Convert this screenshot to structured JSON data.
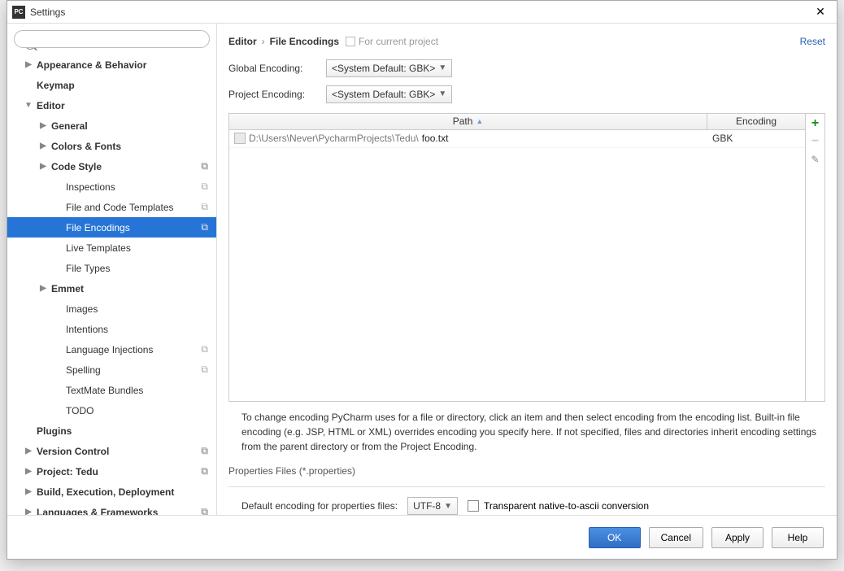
{
  "window": {
    "title": "Settings"
  },
  "sidebar": {
    "search_placeholder": "",
    "items": [
      {
        "label": "Appearance & Behavior",
        "level": 0,
        "arrow": "▶",
        "bold": true
      },
      {
        "label": "Keymap",
        "level": 0,
        "arrow": "",
        "bold": true
      },
      {
        "label": "Editor",
        "level": 0,
        "arrow": "▼",
        "bold": true
      },
      {
        "label": "General",
        "level": 1,
        "arrow": "▶"
      },
      {
        "label": "Colors & Fonts",
        "level": 1,
        "arrow": "▶"
      },
      {
        "label": "Code Style",
        "level": 1,
        "arrow": "▶",
        "badge": true
      },
      {
        "label": "Inspections",
        "level": 2,
        "arrow": "",
        "badge": true
      },
      {
        "label": "File and Code Templates",
        "level": 2,
        "arrow": "",
        "badge": true
      },
      {
        "label": "File Encodings",
        "level": 2,
        "arrow": "",
        "badge": true,
        "selected": true
      },
      {
        "label": "Live Templates",
        "level": 2,
        "arrow": ""
      },
      {
        "label": "File Types",
        "level": 2,
        "arrow": ""
      },
      {
        "label": "Emmet",
        "level": 1,
        "arrow": "▶"
      },
      {
        "label": "Images",
        "level": 2,
        "arrow": ""
      },
      {
        "label": "Intentions",
        "level": 2,
        "arrow": ""
      },
      {
        "label": "Language Injections",
        "level": 2,
        "arrow": "",
        "badge": true
      },
      {
        "label": "Spelling",
        "level": 2,
        "arrow": "",
        "badge": true
      },
      {
        "label": "TextMate Bundles",
        "level": 2,
        "arrow": ""
      },
      {
        "label": "TODO",
        "level": 2,
        "arrow": ""
      },
      {
        "label": "Plugins",
        "level": 0,
        "arrow": "",
        "bold": true
      },
      {
        "label": "Version Control",
        "level": 0,
        "arrow": "▶",
        "bold": true,
        "badge": true
      },
      {
        "label": "Project: Tedu",
        "level": 0,
        "arrow": "▶",
        "bold": true,
        "badge": true
      },
      {
        "label": "Build, Execution, Deployment",
        "level": 0,
        "arrow": "▶",
        "bold": true
      },
      {
        "label": "Languages & Frameworks",
        "level": 0,
        "arrow": "▶",
        "bold": true,
        "badge": true
      }
    ]
  },
  "breadcrumb": {
    "part1": "Editor",
    "part2": "File Encodings",
    "project_hint": "For current project",
    "reset": "Reset"
  },
  "encodings": {
    "global_label": "Global Encoding:",
    "global_value": "<System Default: GBK>",
    "project_label": "Project Encoding:",
    "project_value": "<System Default: GBK>"
  },
  "table": {
    "col_path": "Path",
    "col_encoding": "Encoding",
    "rows": [
      {
        "dir": "D:\\Users\\Never\\PycharmProjects\\Tedu\\",
        "file": "foo.txt",
        "encoding": "GBK"
      }
    ]
  },
  "help": "To change encoding PyCharm uses for a file or directory, click an item and then select encoding from the encoding list. Built-in file encoding (e.g. JSP, HTML or XML) overrides encoding you specify here. If not specified, files and directories inherit encoding settings from the parent directory or from the Project Encoding.",
  "properties": {
    "section_title": "Properties Files (*.properties)",
    "default_label": "Default encoding for properties files:",
    "default_value": "UTF-8",
    "transparent_label": "Transparent native-to-ascii conversion"
  },
  "buttons": {
    "ok": "OK",
    "cancel": "Cancel",
    "apply": "Apply",
    "help": "Help"
  }
}
